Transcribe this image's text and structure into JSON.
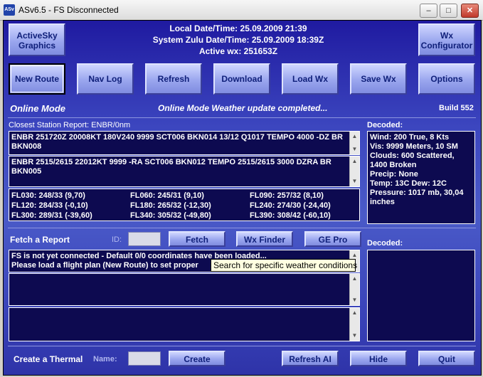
{
  "window": {
    "icon_label": "ASv",
    "title": "ASv6.5 - FS Disconnected",
    "min": "–",
    "max": "□",
    "close": "✕"
  },
  "header": {
    "local_time": "Local Date/Time: 25.09.2009 21:39",
    "zulu_time": "System Zulu Date/Time: 25.09.2009 18:39Z",
    "active_wx": "Active wx: 251653Z"
  },
  "top_buttons": {
    "activesky_line1": "ActiveSky",
    "activesky_line2": "Graphics",
    "wx_line1": "Wx",
    "wx_line2": "Configurator"
  },
  "toolbar": [
    "New Route",
    "Nav Log",
    "Refresh",
    "Download",
    "Load Wx",
    "Save Wx",
    "Options"
  ],
  "status": {
    "mode": "Online Mode",
    "message": "Online Mode Weather update completed...",
    "build": "Build 552"
  },
  "station": {
    "label": "Closest Station Report: ENBR/0nm",
    "metar": "ENBR 251720Z 20008KT 180V240 9999 SCT006 BKN014 13/12 Q1017 TEMPO 4000 -DZ BR BKN008",
    "taf": "ENBR 2515/2615 22012KT 9999 -RA SCT006 BKN012 TEMPO 2515/2615 3000 DZRA BR BKN005",
    "winds": [
      [
        "FL030: 248/33 (9,70)",
        "FL060: 245/31 (9,10)",
        "FL090: 257/32 (8,10)"
      ],
      [
        "FL120: 284/33 (-0,10)",
        "FL180: 265/32 (-12,30)",
        "FL240: 274/30 (-24,40)"
      ],
      [
        "FL300: 289/31 (-39,60)",
        "FL340: 305/32 (-49,80)",
        "FL390: 308/42 (-60,10)"
      ]
    ]
  },
  "decoded": {
    "label": "Decoded:",
    "lines": [
      "Wind: 200 True, 8 Kts",
      "Vis: 9999 Meters, 10 SM",
      "Clouds: 600 Scattered,",
      "1400 Broken",
      "Precip: None",
      "Temp: 13C  Dew: 12C",
      "Pressure: 1017 mb, 30,04",
      "inches"
    ]
  },
  "fetch": {
    "label": "Fetch a Report",
    "id_label": "ID:",
    "id_value": "",
    "fetch": "Fetch",
    "wx_finder": "Wx Finder",
    "ge_pro": "GE Pro",
    "decoded_label": "Decoded:",
    "message_line1": "FS is not yet connected - Default 0/0 coordinates have been loaded...",
    "message_line2": "Please load a flight plan (New Route) to set proper"
  },
  "tooltip": "Search for specific weather conditions",
  "bottom": {
    "thermal_label": "Create a Thermal",
    "name_label": "Name:",
    "name_value": "",
    "create": "Create",
    "refresh_ai": "Refresh AI",
    "hide": "Hide",
    "quit": "Quit"
  }
}
